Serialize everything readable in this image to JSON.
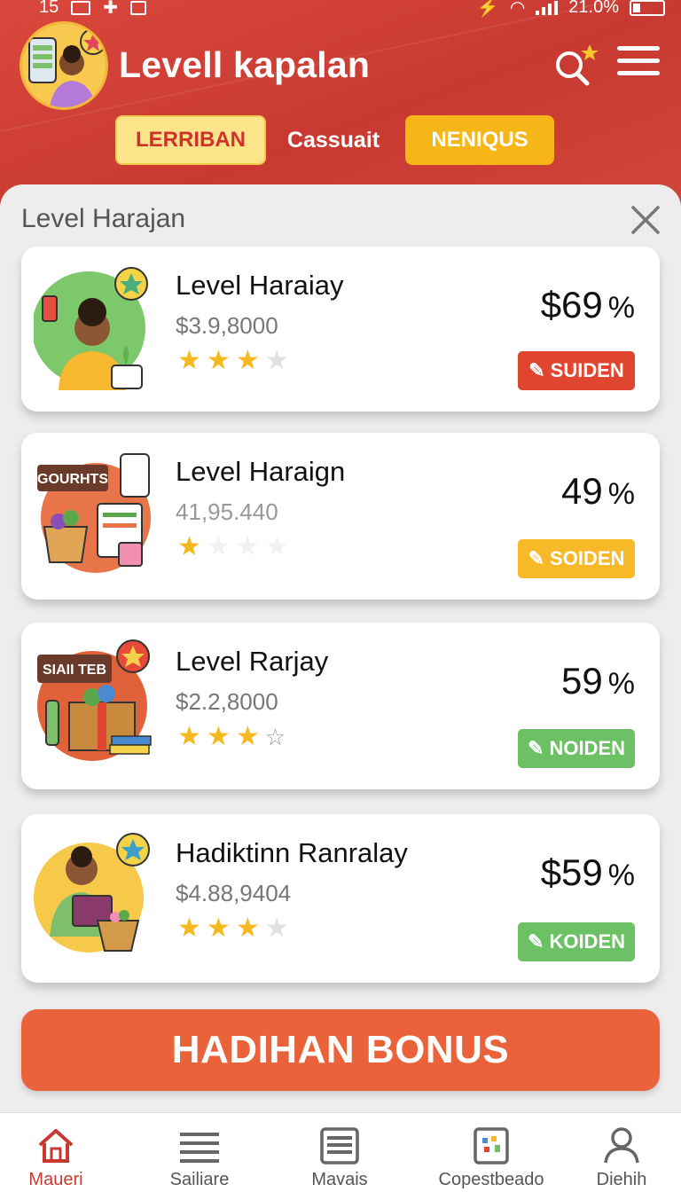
{
  "status": {
    "time": "15",
    "battery_text": "21.0%"
  },
  "header": {
    "title": "Levell kapalan"
  },
  "tabs": [
    {
      "label": "LERRIBAN"
    },
    {
      "label": "Cassuait"
    },
    {
      "label": "NENIQUS"
    }
  ],
  "sheet": {
    "title": "Level Harajan"
  },
  "cards": [
    {
      "name": "Level Haraiay",
      "sub": "$3.9,8000",
      "value": "$69",
      "pct": "%",
      "rating": 3,
      "button": "SUIDEN",
      "button_color": "#e0462f"
    },
    {
      "name": "Level Haraign",
      "sub": "41,95.440",
      "value": "49",
      "pct": "%",
      "rating": 1,
      "button": "SOIDEN",
      "button_color": "#f7b928",
      "badge": "GOURHTS"
    },
    {
      "name": "Level Rarjay",
      "sub": "$2.2,8000",
      "value": "59",
      "pct": "%",
      "rating": 3,
      "button": "NOIDEN",
      "button_color": "#6cc164",
      "badge": "SIAII TEB"
    },
    {
      "name": "Hadiktinn Ranralay",
      "sub": "$4.88,9404",
      "value": "$59",
      "pct": "%",
      "rating": 3,
      "button": "KOIDEN",
      "button_color": "#6cc164"
    }
  ],
  "bonus": {
    "label": "HADIHAN BONUS"
  },
  "nav": [
    {
      "label": "Maueri"
    },
    {
      "label": "Sailiare"
    },
    {
      "label": "Mavais"
    },
    {
      "label": "Copestbeado"
    },
    {
      "label": "Diehih"
    }
  ],
  "colors": {
    "header_red": "#d0433a",
    "accent_orange": "#e9623a",
    "star_gold": "#f6b81c"
  }
}
